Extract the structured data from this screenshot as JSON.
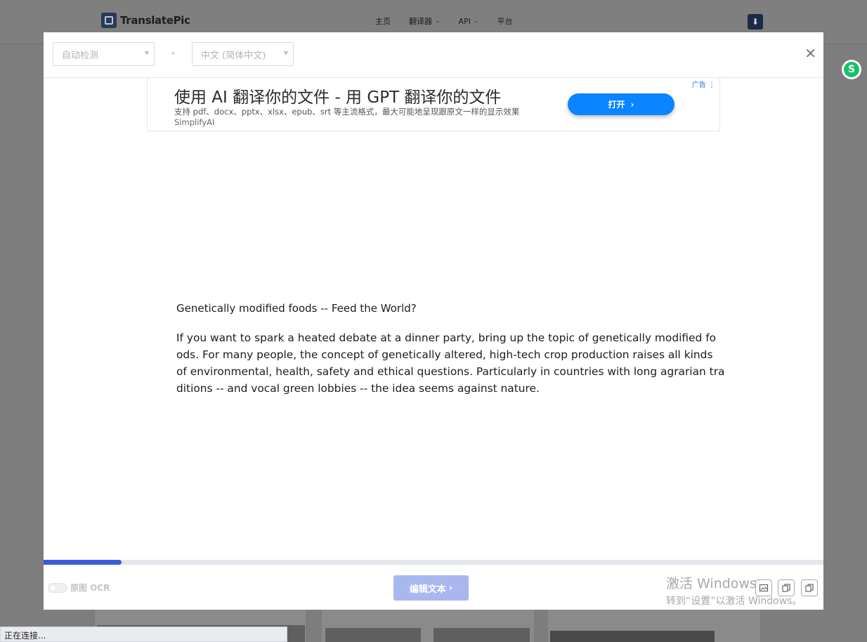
{
  "site": {
    "logo_text": "TranslatePic",
    "nav": [
      {
        "label": "主页",
        "has_dropdown": false
      },
      {
        "label": "翻译器",
        "has_dropdown": true
      },
      {
        "label": "API",
        "has_dropdown": true
      },
      {
        "label": "平台",
        "has_dropdown": false
      }
    ]
  },
  "modal": {
    "source_lang": "自动检测",
    "target_lang": "中文 (简体中文)",
    "separator": "»",
    "close_icon": "close-icon"
  },
  "ad": {
    "title": "使用 AI 翻译你的文件 - 用 GPT 翻译你的文件",
    "description": "支持 pdf、docx、pptx、xlsx、epub、srt 等主流格式，最大可能地呈现跟原文一样的显示效果",
    "sponsor": "SimplifyAI",
    "button": "打开",
    "label": "广告"
  },
  "document": {
    "title": "Genetically modified foods -- Feed the World?",
    "lines": [
      "If you want to spark a heated debate at a dinner party, bring up the topic of genetically modified fo",
      "ods. For many people, the concept of genetically altered, high-tech crop production raises all kinds",
      "of environmental, health, safety and ethical questions. Particularly in countries with long agrarian tra",
      "ditions -- and vocal green lobbies -- the idea seems against nature."
    ]
  },
  "progress": {
    "value": 0.1
  },
  "footer": {
    "toggle_label": "原图 OCR",
    "edit_button": "编辑文本"
  },
  "watermark": {
    "line1": "激活 Windows",
    "line2": "转到“设置”以激活 Windows。"
  },
  "statusbar": {
    "text": "正在连接..."
  },
  "colors": {
    "accent": "#3a5bd9",
    "ad_button": "#0a84ff",
    "edit_button": "#a8b8ef",
    "overlay": "#7d7d7d"
  }
}
